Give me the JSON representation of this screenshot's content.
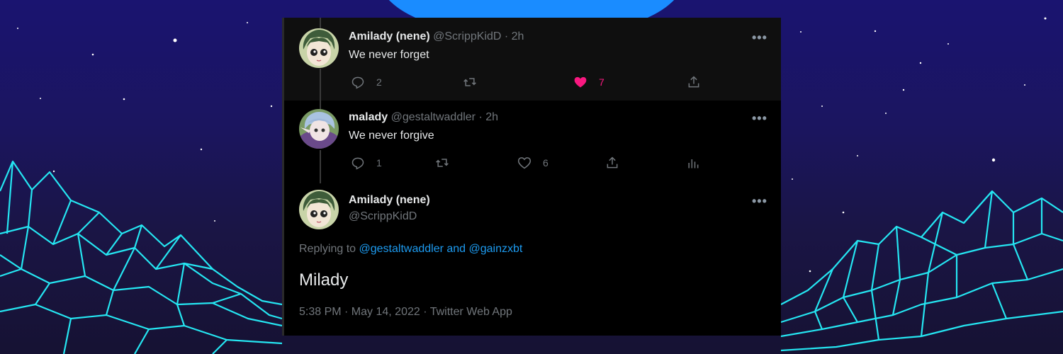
{
  "tweets": [
    {
      "name": "Amilady (nene)",
      "handle": "@ScrippKidD",
      "time": "2h",
      "text": "We never forget",
      "actions": {
        "reply": "2",
        "retweet": "",
        "like": "7"
      },
      "liked": true
    },
    {
      "name": "malady",
      "handle": "@gestaltwaddler",
      "time": "2h",
      "text": "We never forgive",
      "actions": {
        "reply": "1",
        "retweet": "",
        "like": "6"
      },
      "liked": false
    }
  ],
  "main_tweet": {
    "name": "Amilady (nene)",
    "handle": "@ScrippKidD",
    "replying_prefix": "Replying to",
    "replying_users": "@gestaltwaddler and @gainzxbt",
    "text": "Milady",
    "meta": "5:38 PM · May 14, 2022 · Twitter Web App"
  },
  "separator": "·",
  "more_glyph": "•••",
  "colors": {
    "like": "#f91880",
    "link": "#1d9bf0",
    "muted": "#71767b",
    "neon": "#25e6f2",
    "moon": "#1a8cff"
  },
  "icons": [
    "reply-icon",
    "retweet-icon",
    "heart-icon",
    "share-icon",
    "analytics-icon",
    "more-icon"
  ]
}
